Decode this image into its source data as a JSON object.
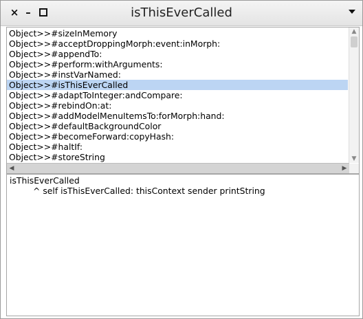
{
  "window": {
    "title": "isThisEverCalled"
  },
  "titlebar": {
    "close_icon": "×",
    "minimize_icon": "–",
    "menu_icon": "chevron-down-icon"
  },
  "method_list": {
    "items": [
      "Object>>#sizeInMemory",
      "Object>>#acceptDroppingMorph:event:inMorph:",
      "Object>>#appendTo:",
      "Object>>#perform:withArguments:",
      "Object>>#instVarNamed:",
      "Object>>#isThisEverCalled",
      "Object>>#adaptToInteger:andCompare:",
      "Object>>#rebindOn:at:",
      "Object>>#addModelMenuItemsTo:forMorph:hand:",
      "Object>>#defaultBackgroundColor",
      "Object>>#becomeForward:copyHash:",
      "Object>>#haltIf:",
      "Object>>#storeString"
    ],
    "selected_index": 5,
    "selection_color": "#bcd5f3"
  },
  "scrollbars": {
    "up_arrow": "▲",
    "down_arrow": "▼",
    "left_arrow": "◀",
    "right_arrow": "▶"
  },
  "source_code": {
    "line1": "isThisEverCalled",
    "line2": "^ self isThisEverCalled: thisContext sender printString"
  }
}
